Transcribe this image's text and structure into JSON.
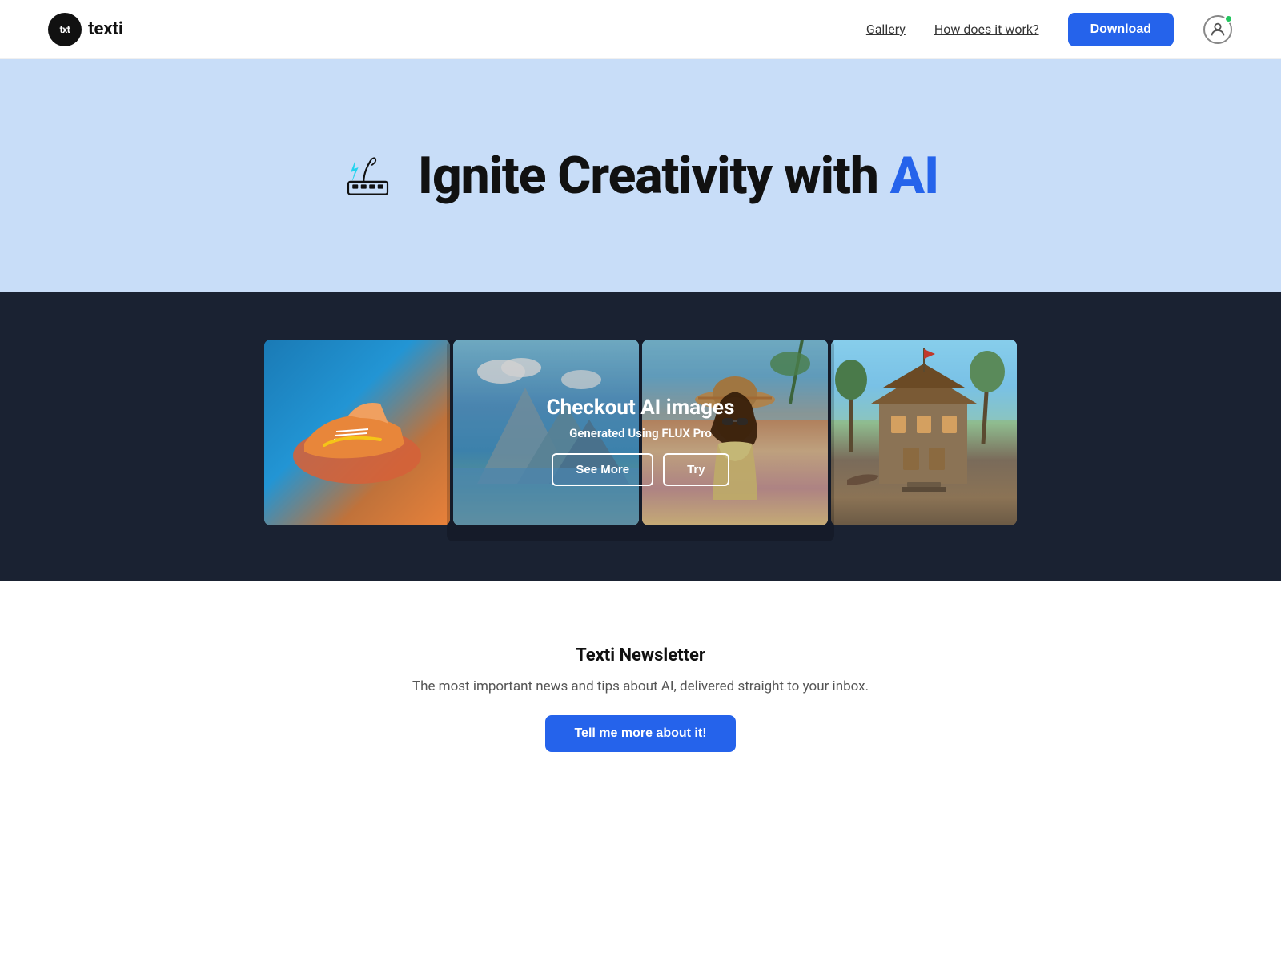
{
  "navbar": {
    "logo_badge": "txt",
    "logo_name": "texti",
    "links": [
      {
        "id": "gallery",
        "label": "Gallery"
      },
      {
        "id": "how-does-it-work",
        "label": "How does it work?"
      }
    ],
    "download_label": "Download",
    "user_status": "online"
  },
  "hero": {
    "title_prefix": "Ignite Creativity with ",
    "title_ai": "AI"
  },
  "gallery": {
    "overlay_title": "Checkout AI images",
    "overlay_sub": "Generated Using FLUX Pro",
    "see_more_label": "See More",
    "try_label": "Try",
    "images": [
      {
        "id": "shoes",
        "alt": "AI generated sneakers"
      },
      {
        "id": "mountain",
        "alt": "AI generated mountain lake"
      },
      {
        "id": "woman",
        "alt": "AI generated woman with hat"
      },
      {
        "id": "house",
        "alt": "AI generated pirate house"
      }
    ]
  },
  "newsletter": {
    "title": "Texti Newsletter",
    "description": "The most important news and tips about AI, delivered straight to your inbox.",
    "cta_label": "Tell me more about it!"
  }
}
